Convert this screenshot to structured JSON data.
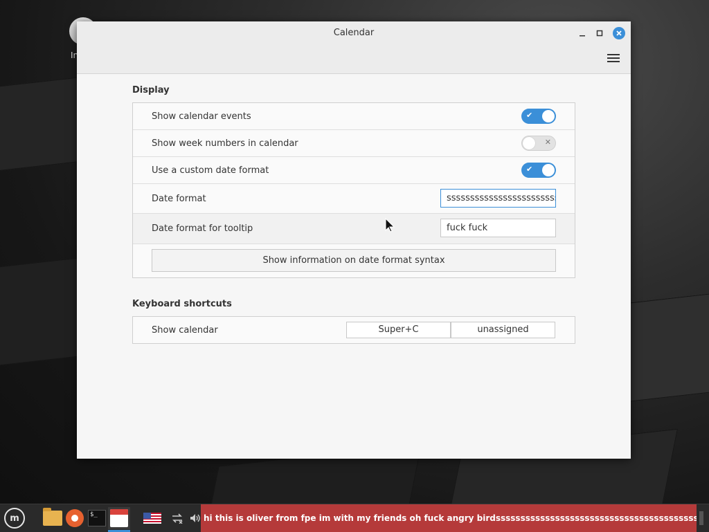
{
  "desktop": {
    "icon_label": "In"
  },
  "window": {
    "title": "Calendar"
  },
  "display": {
    "section_title": "Display",
    "rows": [
      {
        "label": "Show calendar events",
        "type": "switch",
        "on": true
      },
      {
        "label": "Show week numbers in calendar",
        "type": "switch",
        "on": false
      },
      {
        "label": "Use a custom date format",
        "type": "switch",
        "on": true
      },
      {
        "label": "Date format",
        "type": "entry",
        "value": "sssssssssssssssssssssssss"
      },
      {
        "label": "Date format for tooltip",
        "type": "entry",
        "value": "fuck fuck"
      }
    ],
    "info_button_label": "Show information on date format syntax"
  },
  "shortcuts": {
    "section_title": "Keyboard shortcuts",
    "rows": [
      {
        "label": "Show calendar",
        "primary": "Super+C",
        "secondary": "unassigned"
      }
    ]
  },
  "taskbar": {
    "terminal_glyph": "$_",
    "notification_text": "hi this is oliver from fpe im with my friends oh fuck angry birdssssssssssssssssssssssssssssssssssssssssssssssssssssssssssssssssssssssss",
    "icons": [
      "mint-menu-icon",
      "files-icon",
      "firefox-icon",
      "terminal-icon",
      "calendar-icon",
      "us-flag-icon",
      "network-icon",
      "volume-icon"
    ]
  },
  "colors": {
    "accent": "#3b8fd8",
    "notification_bg": "#b53a3a"
  }
}
